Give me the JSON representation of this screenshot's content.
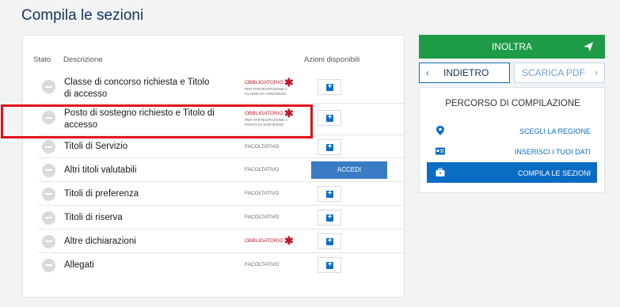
{
  "title": "Compila le sezioni",
  "table": {
    "headers": {
      "stato": "Stato",
      "descrizione": "Descrizione",
      "azioni": "Azioni disponibili"
    },
    "rows": [
      {
        "label": "Classe di concorso richiesta e Titolo di accesso",
        "badge": "OBBLIGATORIO",
        "required": true,
        "sub": "PER PARTECIPAZIONE A CLASSE DI CONCORSO",
        "action": "plus"
      },
      {
        "label": "Posto di sostegno richiesto e Titolo di accesso",
        "badge": "OBBLIGATORIO",
        "required": true,
        "sub": "PER PARTECIPAZIONE A POSTO DI SOSTEGNO",
        "action": "plus"
      },
      {
        "label": "Titoli di Servizio",
        "badge": "FACOLTATIVO",
        "required": false,
        "action": "plus"
      },
      {
        "label": "Altri titoli valutabili",
        "badge": "FACOLTATIVO",
        "required": false,
        "action": "accedi",
        "action_label": "ACCEDI"
      },
      {
        "label": "Titoli di preferenza",
        "badge": "FACOLTATIVO",
        "required": false,
        "action": "plus"
      },
      {
        "label": "Titoli di riserva",
        "badge": "FACOLTATIVO",
        "required": false,
        "action": "plus"
      },
      {
        "label": "Altre dichiarazioni",
        "badge": "OBBLIGATORIO",
        "required": true,
        "action": "plus"
      },
      {
        "label": "Allegati",
        "badge": "FACOLTATIVO",
        "required": false,
        "action": "plus"
      }
    ]
  },
  "sidebar": {
    "inoltra": "INOLTRA",
    "indietro": "INDIETRO",
    "scarica": "SCARICA PDF",
    "percorso_title": "PERCORSO DI COMPILAZIONE",
    "steps": [
      {
        "label": "SCEGLI LA REGIONE",
        "icon": "map-pin-icon",
        "active": false
      },
      {
        "label": "INSERISCI I TUOI DATI",
        "icon": "id-card-icon",
        "active": false
      },
      {
        "label": "COMPILA LE SEZIONI",
        "icon": "briefcase-icon",
        "active": true
      }
    ]
  },
  "colors": {
    "primary": "#0b6cc4",
    "success": "#1e9b47",
    "required": "#c0172b",
    "highlight": "#e0101a"
  }
}
